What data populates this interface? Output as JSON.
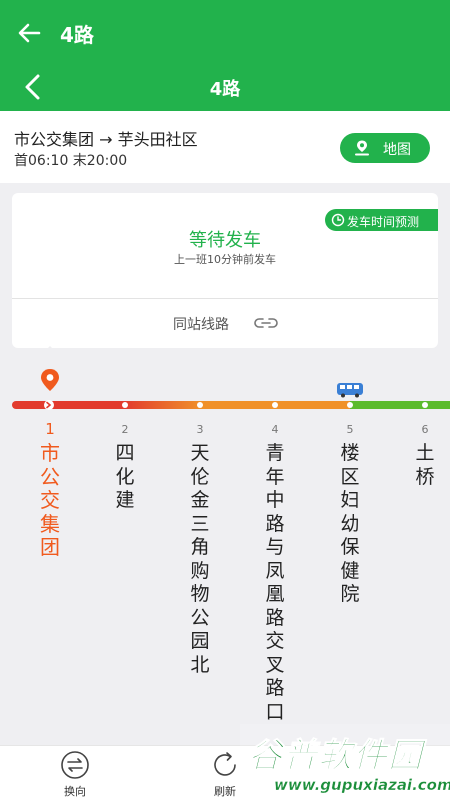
{
  "appbar": {
    "title": "4路"
  },
  "navbar": {
    "title": "4路"
  },
  "route_info": {
    "route": "市公交集团 → 芋头田社区",
    "times": "首06:10 末20:00",
    "map_label": "地图"
  },
  "arrival": {
    "predict_label": "发车时间预测",
    "status": "等待发车",
    "detail": "上一班10分钟前发车",
    "same_station_label": "同站线路"
  },
  "stops": [
    {
      "num": "1",
      "name": "市公交集团"
    },
    {
      "num": "2",
      "name": "四化建"
    },
    {
      "num": "3",
      "name": "天伦金三角购物公园北"
    },
    {
      "num": "4",
      "name": "青年中路与凤凰路交叉路口"
    },
    {
      "num": "5",
      "name": "楼区妇幼保健院"
    },
    {
      "num": "6",
      "name": "土桥"
    }
  ],
  "current_stop": 1,
  "bus_at_stop": 5,
  "colors": {
    "brand": "#22b24c",
    "current": "#f05a1e",
    "line_red": "#e23b2e",
    "line_orange": "#f0912a",
    "line_green": "#5cbb2e"
  },
  "bottom": {
    "reverse_label": "换向",
    "refresh_label": "刷新"
  },
  "watermark": {
    "big": "谷普软件园",
    "small": "www.gupuxiazai.com"
  }
}
